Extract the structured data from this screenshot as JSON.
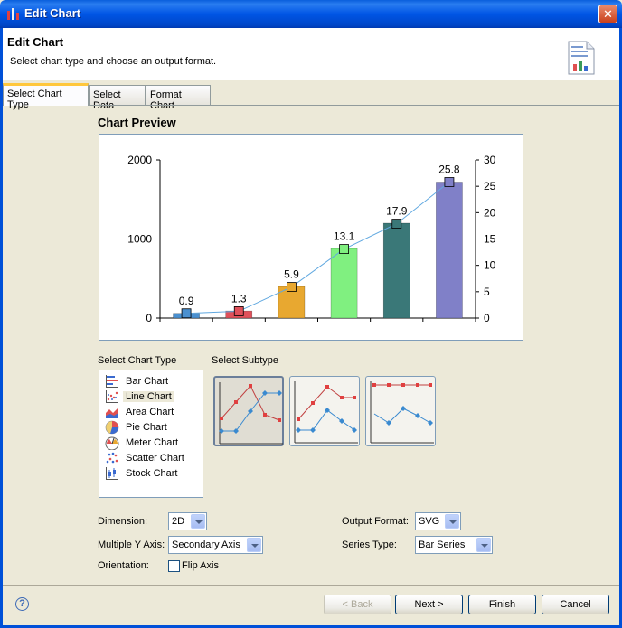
{
  "window": {
    "title": "Edit Chart",
    "close_glyph": "✕"
  },
  "header": {
    "title": "Edit Chart",
    "description": "Select chart type and choose an output format."
  },
  "tabs": [
    {
      "label": "Select Chart Type",
      "active": true
    },
    {
      "label": "Select Data",
      "active": false
    },
    {
      "label": "Format Chart",
      "active": false
    }
  ],
  "preview": {
    "title": "Chart Preview",
    "chart_data": {
      "type": "bar",
      "categories": [
        "",
        "",
        "",
        "",
        "",
        ""
      ],
      "series": [
        {
          "type": "bar",
          "axis": "left",
          "values": [
            60,
            90,
            400,
            880,
            1200,
            1720
          ],
          "colors": [
            "#4a90d0",
            "#e0505a",
            "#e8a830",
            "#80f080",
            "#3a7878",
            "#8080c8"
          ]
        },
        {
          "type": "line",
          "axis": "right",
          "values": [
            0.9,
            1.3,
            5.9,
            13.1,
            17.9,
            25.8
          ],
          "labels": [
            "0.9",
            "1.3",
            "5.9",
            "13.1",
            "17.9",
            "25.8"
          ],
          "color": "#60a8e0"
        }
      ],
      "y_left": {
        "min": 0,
        "max": 2000,
        "ticks": [
          "0",
          "1000",
          "2000"
        ]
      },
      "y_right": {
        "min": 0,
        "max": 30,
        "ticks": [
          "0",
          "5",
          "10",
          "15",
          "20",
          "25",
          "30"
        ]
      },
      "title": "",
      "xlabel": "",
      "ylabel": ""
    }
  },
  "chart_type": {
    "label": "Select Chart Type",
    "items": [
      {
        "label": "Bar Chart",
        "icon": "bar-chart-icon",
        "selected": false
      },
      {
        "label": "Line Chart",
        "icon": "line-chart-icon",
        "selected": true
      },
      {
        "label": "Area Chart",
        "icon": "area-chart-icon",
        "selected": false
      },
      {
        "label": "Pie Chart",
        "icon": "pie-chart-icon",
        "selected": false
      },
      {
        "label": "Meter Chart",
        "icon": "meter-chart-icon",
        "selected": false
      },
      {
        "label": "Scatter Chart",
        "icon": "scatter-chart-icon",
        "selected": false
      },
      {
        "label": "Stock Chart",
        "icon": "stock-chart-icon",
        "selected": false
      }
    ]
  },
  "subtype": {
    "label": "Select Subtype",
    "selected_index": 0
  },
  "options": {
    "dimension_label": "Dimension:",
    "dimension_value": "2D",
    "multiple_y_label": "Multiple Y Axis:",
    "multiple_y_value": "Secondary Axis",
    "orientation_label": "Orientation:",
    "flip_axis_label": "Flip Axis",
    "flip_axis_checked": false,
    "output_format_label": "Output Format:",
    "output_format_value": "SVG",
    "series_type_label": "Series Type:",
    "series_type_value": "Bar Series"
  },
  "footer": {
    "help_glyph": "?",
    "back_label": "< Back",
    "next_label": "Next >",
    "finish_label": "Finish",
    "cancel_label": "Cancel"
  }
}
